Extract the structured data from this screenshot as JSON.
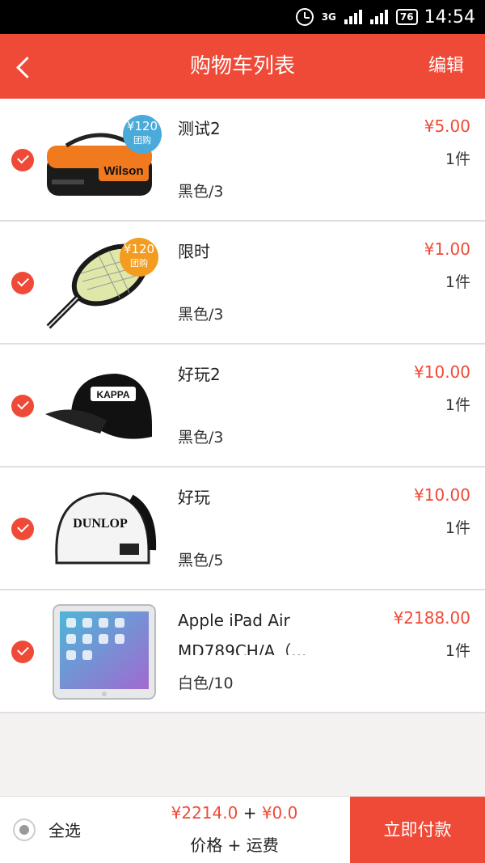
{
  "status_bar": {
    "time": "14:54",
    "battery": "76",
    "network": "3G"
  },
  "header": {
    "title": "购物车列表",
    "edit_label": "编辑"
  },
  "items": [
    {
      "name": "测试2",
      "spec": "黑色/3",
      "price": "¥5.00",
      "qty": "1件",
      "badge_price": "¥120",
      "badge_label": "团购",
      "badge_color": "#4aaad9",
      "image": "tennis-bag-icon"
    },
    {
      "name": "限时",
      "spec": "黑色/3",
      "price": "¥1.00",
      "qty": "1件",
      "badge_price": "¥120",
      "badge_label": "团购",
      "badge_color": "#f39c1f",
      "image": "tennis-racket-icon"
    },
    {
      "name": "好玩2",
      "spec": "黑色/3",
      "price": "¥10.00",
      "qty": "1件",
      "image": "black-cap-icon"
    },
    {
      "name": "好玩",
      "spec": "黑色/5",
      "price": "¥10.00",
      "qty": "1件",
      "image": "white-cap-icon"
    },
    {
      "name": "Apple iPad Air MD789CH/A（...",
      "spec": "白色/10",
      "price": "¥2188.00",
      "qty": "1件",
      "image": "ipad-icon"
    }
  ],
  "footer": {
    "select_all_label": "全选",
    "total_price": "¥2214.0",
    "plus": "+",
    "shipping": "¥0.0",
    "sub_label": "价格 + 运费",
    "pay_label": "立即付款"
  },
  "colors": {
    "accent": "#ef4a37",
    "background": "#f4f1f1"
  }
}
